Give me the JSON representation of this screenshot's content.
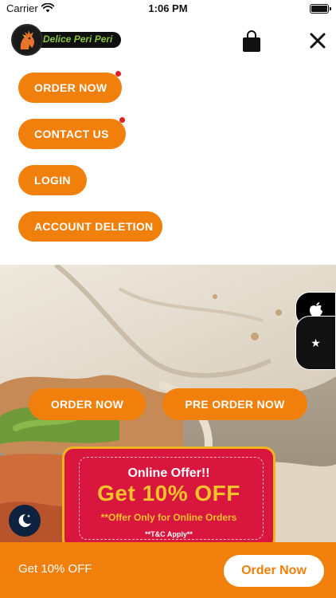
{
  "status_bar": {
    "carrier": "Carrier",
    "time": "1:06 PM"
  },
  "header": {
    "brand": "Delice Peri Peri",
    "bag_icon": "shopping-bag-icon",
    "close_icon": "close-icon"
  },
  "menu": {
    "items": [
      {
        "label": "ORDER NOW",
        "has_dot": true
      },
      {
        "label": "CONTACT US",
        "has_dot": true
      },
      {
        "label": "LOGIN",
        "has_dot": false
      },
      {
        "label": "ACCOUNT DELETION",
        "has_dot": false
      }
    ]
  },
  "hero": {
    "order_now_label": "ORDER NOW",
    "pre_order_label": "PRE ORDER NOW"
  },
  "offer": {
    "title": "Online Offer!!",
    "headline": "Get 10% OFF",
    "subtitle": "**Offer Only for Online Orders",
    "terms": "**T&C Apply**"
  },
  "side_tabs": {
    "top_icon": "apple-icon",
    "bottom_icon": "star-icon"
  },
  "bottom_bar": {
    "text": "Get 10% OFF",
    "button_label": "Order Now"
  },
  "colors": {
    "accent": "#f07f0b",
    "offer_red": "#d9173e",
    "offer_yellow": "#f6c22c",
    "night_button": "#0e2240"
  }
}
